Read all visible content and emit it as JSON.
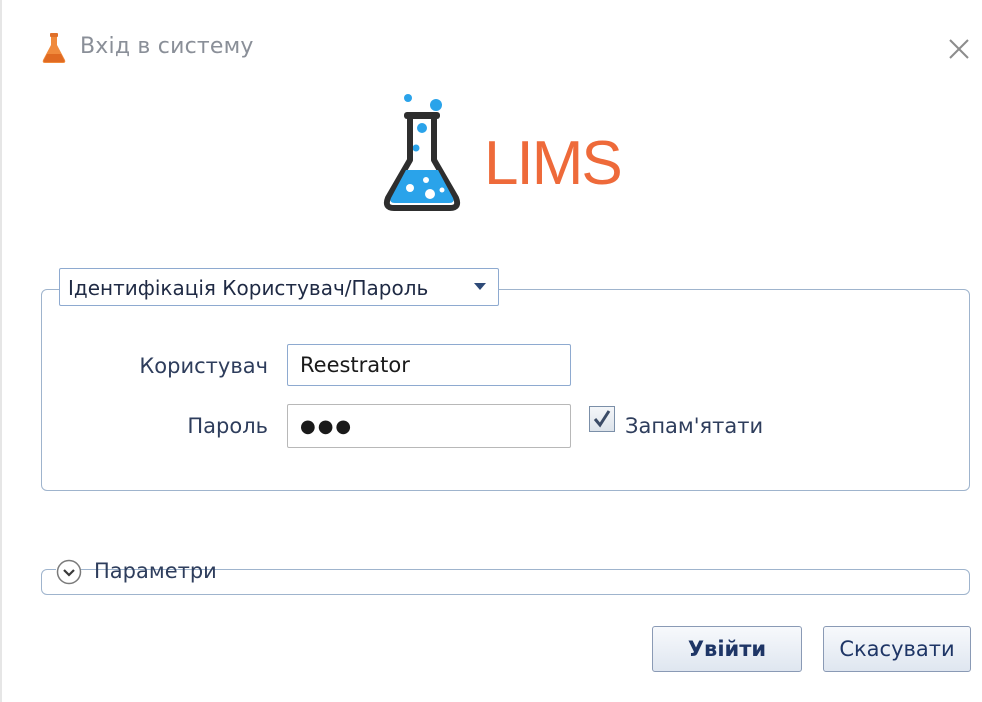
{
  "window": {
    "title": "Вхід в систему",
    "icons": {
      "app": "flask-icon",
      "close": "close-icon"
    }
  },
  "logo": {
    "text": "LIMS",
    "accent_color": "#ee6a3a",
    "flask_color": "#2aa3ea"
  },
  "auth": {
    "mode_selected": "Ідентифікація Користувач/Пароль",
    "user_label": "Користувач",
    "user_value": "Reestrator",
    "password_label": "Пароль",
    "password_value_masked": "●●●",
    "remember_label": "Запам'ятати",
    "remember_checked": true
  },
  "params": {
    "label": "Параметри",
    "expanded": false
  },
  "buttons": {
    "login": "Увійти",
    "cancel": "Скасувати"
  }
}
